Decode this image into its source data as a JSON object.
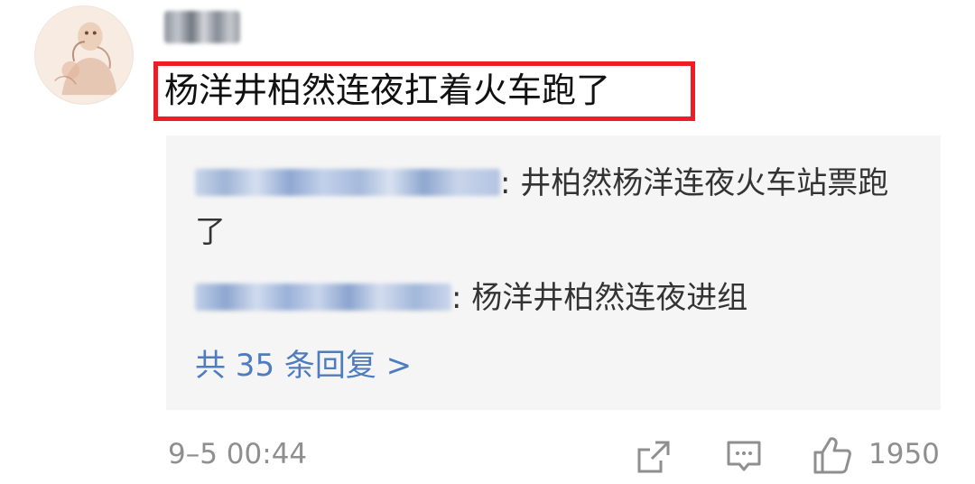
{
  "comment": {
    "text": "杨洋井柏然连夜扛着火车跑了",
    "highlight_color": "#ee1d23"
  },
  "replies": {
    "items": [
      {
        "text": ": 井柏然杨洋连夜火车站票跑了"
      },
      {
        "text": ": 杨洋井柏然连夜进组"
      }
    ],
    "more_label": "共 35 条回复 >",
    "link_color": "#4e7cbf"
  },
  "footer": {
    "timestamp": "9–5 00:44",
    "like_count": "1950",
    "icons": [
      "share-icon",
      "comment-icon",
      "like-icon"
    ]
  }
}
